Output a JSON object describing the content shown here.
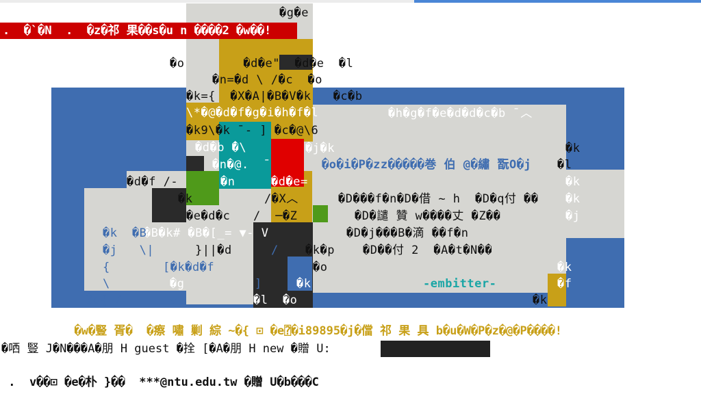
{
  "window": {
    "accent_color": "#4a86d6"
  },
  "ansi_art": {
    "top_text": "�g�e",
    "banner": ".  �`�N  .  �z�祁 果��s�u n ����2 �w��!",
    "rows": [
      {
        "t": "�o        �d�e\"  �d�e  �l"
      },
      {
        "t": "�n=�d \\ /�c  �o"
      },
      {
        "t": "�k={  �X�A|�B�V�k   �c�b"
      },
      {
        "t": "\\*�@�d�f�g�i�h�f�l"
      },
      {
        "t": "�k9\\�k ̄ - ] �c�@\\6"
      },
      {
        "t": "�d�b ̄�\\"
      },
      {
        "t": "�n�@.  ̄"
      },
      {
        "t": "�n"
      },
      {
        "t": "�k"
      },
      {
        "t": "�e�d�c"
      },
      {
        "t": "�B�k# �B�[_= ▼- V"
      },
      {
        "t": "}||�d"
      },
      {
        "t": "[�k�d�f"
      },
      {
        "t": "�g"
      },
      {
        "t": "▼"
      }
    ],
    "right_panel": [
      "�h�g�f�e�d�d�c�b ̄ ︿",
      "�o�i�P�zz�����巻 伯 @�繡 翫O�j",
      "�D���f�n�D�借 ~ h  �D�q付 ��",
      "�D�譴 贊 w����丈 �Z��",
      "�D�j���B�滴 ��f�n",
      "�D��付 2  �A�t�N��"
    ],
    "left_col": [
      "�d�f /-",
      "�k  �B",
      "�j   \\|",
      "{",
      "\\",
      "�o{ /"
    ],
    "right_col": [
      "�k",
      "�l",
      "�k",
      "�k",
      "�j",
      "�k",
      "�f",
      "�k"
    ],
    "misc": [
      "�j�k",
      "�d�e=",
      "/�X︿",
      "/  ─�Z",
      "�k�p",
      "�o",
      "�k",
      "�l  �o",
      "]",
      "/"
    ],
    "emb_label": "-embitter-",
    "marquee": "�w�豎 胥�  �瘵 嘯 剿 綜 ~�{ ⊡ �e⍰�i89895�j�儅 祁 果 具 b�u�W�P�z�@�P����!"
  },
  "login": {
    "prompt_text": "�哂 豎 J�N���A�朋 H guest �拴 [�A�朋 H new �贈 U:",
    "input_value": ""
  },
  "mail": {
    "text": " .  v��⊡ �e�朴 }��  ***@ntu.edu.tw �贈 U�b���C"
  }
}
